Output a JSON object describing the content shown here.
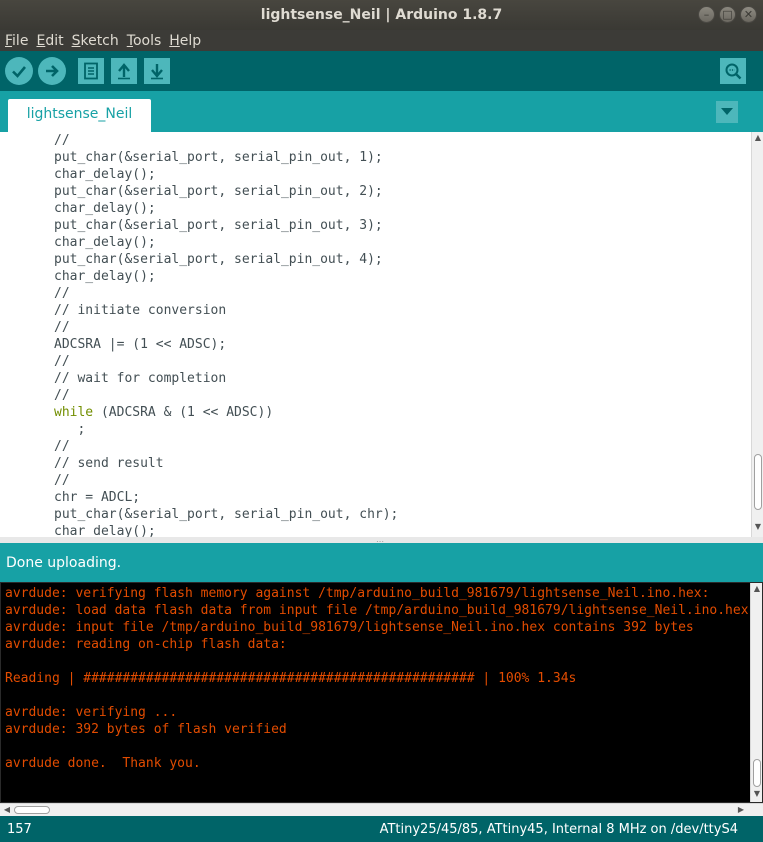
{
  "window": {
    "title": "lightsense_Neil | Arduino 1.8.7",
    "controls": [
      "minimize",
      "maximize",
      "close"
    ]
  },
  "menu": [
    {
      "label": "File",
      "mnemonic": "F",
      "rest": "ile"
    },
    {
      "label": "Edit",
      "mnemonic": "E",
      "rest": "dit"
    },
    {
      "label": "Sketch",
      "mnemonic": "S",
      "rest": "ketch"
    },
    {
      "label": "Tools",
      "mnemonic": "T",
      "rest": "ools"
    },
    {
      "label": "Help",
      "mnemonic": "H",
      "rest": "elp"
    }
  ],
  "toolbar": {
    "verify_icon": "checkmark-icon",
    "upload_icon": "arrow-right-icon",
    "new_icon": "new-file-icon",
    "open_icon": "arrow-up-icon",
    "save_icon": "arrow-down-icon",
    "serial_monitor_icon": "magnifier-icon"
  },
  "tabs": {
    "active": "lightsense_Neil",
    "menu_icon": "triangle-down-icon"
  },
  "editor": {
    "lines": [
      {
        "t": "//",
        "kw": false
      },
      {
        "t": "put_char(&serial_port, serial_pin_out, 1);",
        "kw": false
      },
      {
        "t": "char_delay();",
        "kw": false
      },
      {
        "t": "put_char(&serial_port, serial_pin_out, 2);",
        "kw": false
      },
      {
        "t": "char_delay();",
        "kw": false
      },
      {
        "t": "put_char(&serial_port, serial_pin_out, 3);",
        "kw": false
      },
      {
        "t": "char_delay();",
        "kw": false
      },
      {
        "t": "put_char(&serial_port, serial_pin_out, 4);",
        "kw": false
      },
      {
        "t": "char_delay();",
        "kw": false
      },
      {
        "t": "//",
        "kw": false
      },
      {
        "t": "// initiate conversion",
        "kw": false
      },
      {
        "t": "//",
        "kw": false
      },
      {
        "t": "ADCSRA |= (1 << ADSC);",
        "kw": false
      },
      {
        "t": "//",
        "kw": false
      },
      {
        "t": "// wait for completion",
        "kw": false
      },
      {
        "t": "//",
        "kw": false
      },
      {
        "t": " (ADCSRA & (1 << ADSC))",
        "kw": true,
        "kwText": "while"
      },
      {
        "t": "   ;",
        "kw": false
      },
      {
        "t": "//",
        "kw": false
      },
      {
        "t": "// send result",
        "kw": false
      },
      {
        "t": "//",
        "kw": false
      },
      {
        "t": "chr = ADCL;",
        "kw": false
      },
      {
        "t": "put_char(&serial_port, serial_pin_out, chr);",
        "kw": false
      },
      {
        "t": "char_delay();",
        "kw": false
      }
    ]
  },
  "status": {
    "message": "Done uploading."
  },
  "console": {
    "lines": [
      "avrdude: verifying flash memory against /tmp/arduino_build_981679/lightsense_Neil.ino.hex:",
      "avrdude: load data flash data from input file /tmp/arduino_build_981679/lightsense_Neil.ino.hex:",
      "avrdude: input file /tmp/arduino_build_981679/lightsense_Neil.ino.hex contains 392 bytes",
      "avrdude: reading on-chip flash data:",
      "",
      "Reading | ################################################## | 100% 1.34s",
      "",
      "avrdude: verifying ...",
      "avrdude: 392 bytes of flash verified",
      "",
      "avrdude done.  Thank you.",
      ""
    ]
  },
  "footer": {
    "line_number": "157",
    "board": "ATtiny25/45/85, ATtiny45, Internal 8 MHz on /dev/ttyS4"
  }
}
